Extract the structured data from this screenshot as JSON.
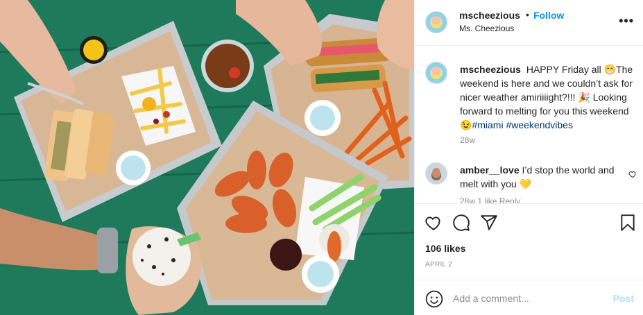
{
  "post": {
    "username": "mscheezious",
    "display_name": "Ms. Cheezious",
    "follow_label": "Follow",
    "dot": "•",
    "more_label": "•••"
  },
  "caption": {
    "username": "mscheezious",
    "text_1": "HAPPY Friday all 😁The weekend is here and we couldn’t ask for nicer weather amiriiiight?!!! 🎉 Looking forward to melting for you this weekend 😉",
    "tag_1": "#miami",
    "tag_2": "#weekendvibes",
    "age": "28w"
  },
  "comments": [
    {
      "username": "amber__love",
      "text": "I’d stop the world and melt with you 💛"
    }
  ],
  "comment_peek": "28w   1 like   Reply",
  "likes": "106 likes",
  "date": "APRIL 2",
  "add_comment": {
    "placeholder": "Add a comment...",
    "post_label": "Post"
  },
  "icons": {
    "header_more": "more-icon",
    "like": "heart-icon",
    "comment": "comment-icon",
    "share": "share-icon",
    "save": "bookmark-icon",
    "emoji": "emoji-icon"
  },
  "colors": {
    "accent": "#0095f6",
    "post_disabled": "#b2dffc",
    "hashtag": "#00376b",
    "table_green": "#1f7a5c"
  }
}
